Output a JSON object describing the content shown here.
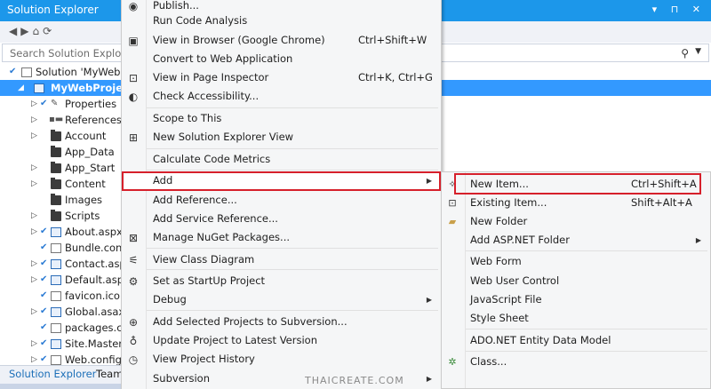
{
  "panel": {
    "title": "Solution Explorer",
    "title_buttons": "▾ ⊓ ✕",
    "search_placeholder": "Search Solution Explorer"
  },
  "tree": [
    {
      "label": "Solution 'MyWebPr"
    },
    {
      "label": "MyWebProject"
    },
    {
      "label": "Properties"
    },
    {
      "label": "References"
    },
    {
      "label": "Account"
    },
    {
      "label": "App_Data"
    },
    {
      "label": "App_Start"
    },
    {
      "label": "Content"
    },
    {
      "label": "Images"
    },
    {
      "label": "Scripts"
    },
    {
      "label": "About.aspx"
    },
    {
      "label": "Bundle.conf"
    },
    {
      "label": "Contact.aspx"
    },
    {
      "label": "Default.aspx"
    },
    {
      "label": "favicon.ico"
    },
    {
      "label": "Global.asax"
    },
    {
      "label": "packages.co"
    },
    {
      "label": "Site.Master"
    },
    {
      "label": "Web.config"
    }
  ],
  "tabs": [
    "Solution Explorer",
    "Team"
  ],
  "context_menu": [
    {
      "label": "Publish...",
      "shortcut": "",
      "icon": "publish-icon"
    },
    {
      "label": "Run Code Analysis",
      "shortcut": "",
      "icon": ""
    },
    {
      "label": "View in Browser (Google Chrome)",
      "shortcut": "Ctrl+Shift+W",
      "icon": "browser-icon"
    },
    {
      "label": "Convert to Web Application",
      "shortcut": "",
      "icon": ""
    },
    {
      "label": "View in Page Inspector",
      "shortcut": "Ctrl+K, Ctrl+G",
      "icon": "page-inspector-icon"
    },
    {
      "label": "Check Accessibility...",
      "shortcut": "",
      "icon": "accessibility-icon"
    },
    {
      "label": "Scope to This",
      "shortcut": "",
      "icon": ""
    },
    {
      "label": "New Solution Explorer View",
      "shortcut": "",
      "icon": "solution-explorer-view-icon"
    },
    {
      "label": "Calculate Code Metrics",
      "shortcut": "",
      "icon": ""
    },
    {
      "label": "Add",
      "shortcut": "",
      "icon": ""
    },
    {
      "label": "Add Reference...",
      "shortcut": "",
      "icon": ""
    },
    {
      "label": "Add Service Reference...",
      "shortcut": "",
      "icon": ""
    },
    {
      "label": "Manage NuGet Packages...",
      "shortcut": "",
      "icon": "nuget-icon"
    },
    {
      "label": "View Class Diagram",
      "shortcut": "",
      "icon": "class-diagram-icon"
    },
    {
      "label": "Set as StartUp Project",
      "shortcut": "",
      "icon": "gear-icon"
    },
    {
      "label": "Debug",
      "shortcut": "",
      "icon": ""
    },
    {
      "label": "Add Selected Projects to Subversion...",
      "shortcut": "",
      "icon": "subversion-add-icon"
    },
    {
      "label": "Update Project to Latest Version",
      "shortcut": "",
      "icon": "update-icon"
    },
    {
      "label": "View Project History",
      "shortcut": "",
      "icon": "history-icon"
    },
    {
      "label": "Subversion",
      "shortcut": "",
      "icon": ""
    }
  ],
  "add_submenu": [
    {
      "label": "New Item...",
      "shortcut": "Ctrl+Shift+A"
    },
    {
      "label": "Existing Item...",
      "shortcut": "Shift+Alt+A"
    },
    {
      "label": "New Folder",
      "shortcut": ""
    },
    {
      "label": "Add ASP.NET Folder",
      "shortcut": ""
    },
    {
      "label": "Web Form",
      "shortcut": ""
    },
    {
      "label": "Web User Control",
      "shortcut": ""
    },
    {
      "label": "JavaScript File",
      "shortcut": ""
    },
    {
      "label": "Style Sheet",
      "shortcut": ""
    },
    {
      "label": "ADO.NET Entity Data Model",
      "shortcut": ""
    },
    {
      "label": "Class...",
      "shortcut": ""
    }
  ],
  "watermark": "THAICREATE.COM",
  "colors": {
    "accent": "#1c97ea",
    "selection": "#3399ff",
    "highlight_border": "#d6202b"
  }
}
